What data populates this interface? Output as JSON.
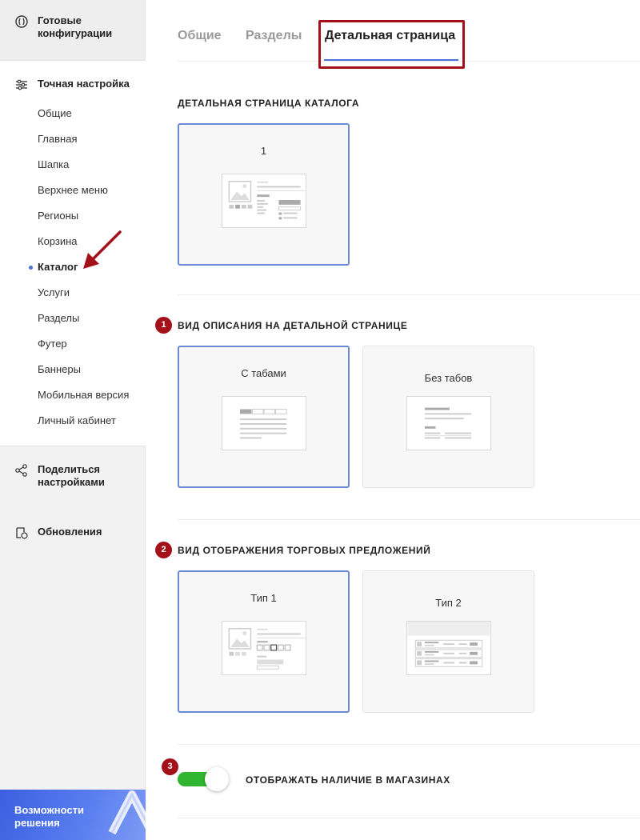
{
  "sidebar": {
    "ready_configs": "Готовые конфигурации",
    "fine_tuning": "Точная настройка",
    "items": [
      {
        "label": "Общие"
      },
      {
        "label": "Главная"
      },
      {
        "label": "Шапка"
      },
      {
        "label": "Верхнее меню"
      },
      {
        "label": "Регионы"
      },
      {
        "label": "Корзина"
      },
      {
        "label": "Каталог"
      },
      {
        "label": "Услуги"
      },
      {
        "label": "Разделы"
      },
      {
        "label": "Футер"
      },
      {
        "label": "Баннеры"
      },
      {
        "label": "Мобильная версия"
      },
      {
        "label": "Личный кабинет"
      }
    ],
    "active_item": "Каталог",
    "share_settings": "Поделиться настройками",
    "updates": "Обновления",
    "promo": "Возможности решения"
  },
  "tabs": [
    {
      "label": "Общие"
    },
    {
      "label": "Разделы"
    },
    {
      "label": "Детальная страница"
    }
  ],
  "active_tab": "Детальная страница",
  "sections": {
    "catalog_detail": {
      "title": "ДЕТАЛЬНАЯ СТРАНИЦА КАТАЛОГА",
      "options": [
        {
          "label": "1",
          "selected": true
        }
      ]
    },
    "description_view": {
      "badge": "1",
      "title": "ВИД ОПИСАНИЯ НА ДЕТАЛЬНОЙ СТРАНИЦЕ",
      "options": [
        {
          "label": "С табами",
          "selected": true
        },
        {
          "label": "Без табов",
          "selected": false
        }
      ]
    },
    "offers_view": {
      "badge": "2",
      "title": "ВИД ОТОБРАЖЕНИЯ ТОРГОВЫХ ПРЕДЛОЖЕНИЙ",
      "options": [
        {
          "label": "Тип 1",
          "selected": true
        },
        {
          "label": "Тип 2",
          "selected": false
        }
      ]
    },
    "stores_toggle": {
      "badge": "3",
      "label": "ОТОБРАЖАТЬ НАЛИЧИЕ В МАГАЗИНАХ",
      "enabled": true
    }
  },
  "colors": {
    "accent": "#4a72d6",
    "highlight": "#a3101a",
    "toggle_on": "#2fb52f"
  }
}
